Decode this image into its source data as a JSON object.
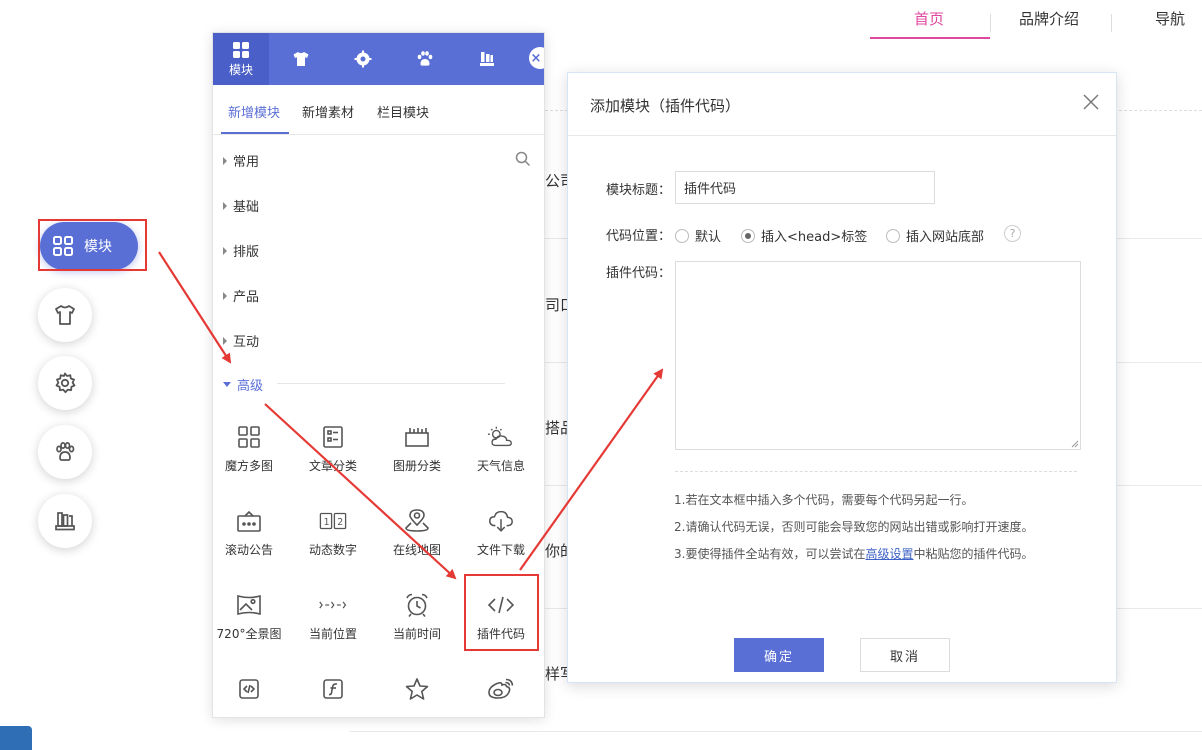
{
  "site_nav": {
    "home": "首页",
    "brand": "品牌介绍",
    "nav": "导航"
  },
  "background_fragments": [
    "公司",
    "司口",
    "搭品",
    "你的",
    "样写"
  ],
  "float_toolbar": {
    "module_label": "模块",
    "icons": [
      "shirt-icon",
      "gear-icon",
      "paw-icon",
      "books-icon"
    ]
  },
  "panel": {
    "tabs": [
      {
        "icon": "grid-icon",
        "label": "模块"
      },
      {
        "icon": "shirt-icon",
        "label": ""
      },
      {
        "icon": "gear-icon",
        "label": ""
      },
      {
        "icon": "paw-icon",
        "label": ""
      },
      {
        "icon": "books-icon",
        "label": ""
      }
    ],
    "close_label": "×",
    "subtabs": [
      "新增模块",
      "新增素材",
      "栏目模块"
    ],
    "categories": [
      "常用",
      "基础",
      "排版",
      "产品",
      "互动",
      "高级"
    ],
    "advanced_items": [
      "魔方多图",
      "文章分类",
      "图册分类",
      "天气信息",
      "滚动公告",
      "动态数字",
      "在线地图",
      "文件下载",
      "720°全景图",
      "当前位置",
      "当前时间",
      "插件代码"
    ]
  },
  "dialog": {
    "title": "添加模块（插件代码）",
    "title_label": "模块标题：",
    "title_value": "插件代码",
    "position_label": "代码位置：",
    "position_options": [
      "默认",
      "插入<head>标签",
      "插入网站底部"
    ],
    "position_selected": 1,
    "help": "?",
    "code_label": "插件代码：",
    "notes": [
      "1.若在文本框中插入多个代码，需要每个代码另起一行。",
      "2.请确认代码无误，否则可能会导致您的网站出错或影响打开速度。"
    ],
    "note3_prefix": "3.要使得插件全站有效，可以尝试在",
    "note3_link": "高级设置",
    "note3_suffix": "中粘贴您的插件代码。",
    "ok": "确定",
    "cancel": "取消"
  },
  "colors": {
    "accent": "#5a6fd6",
    "nav_active": "#e0479e",
    "annotation": "#e53935",
    "link": "#3e63c6"
  }
}
